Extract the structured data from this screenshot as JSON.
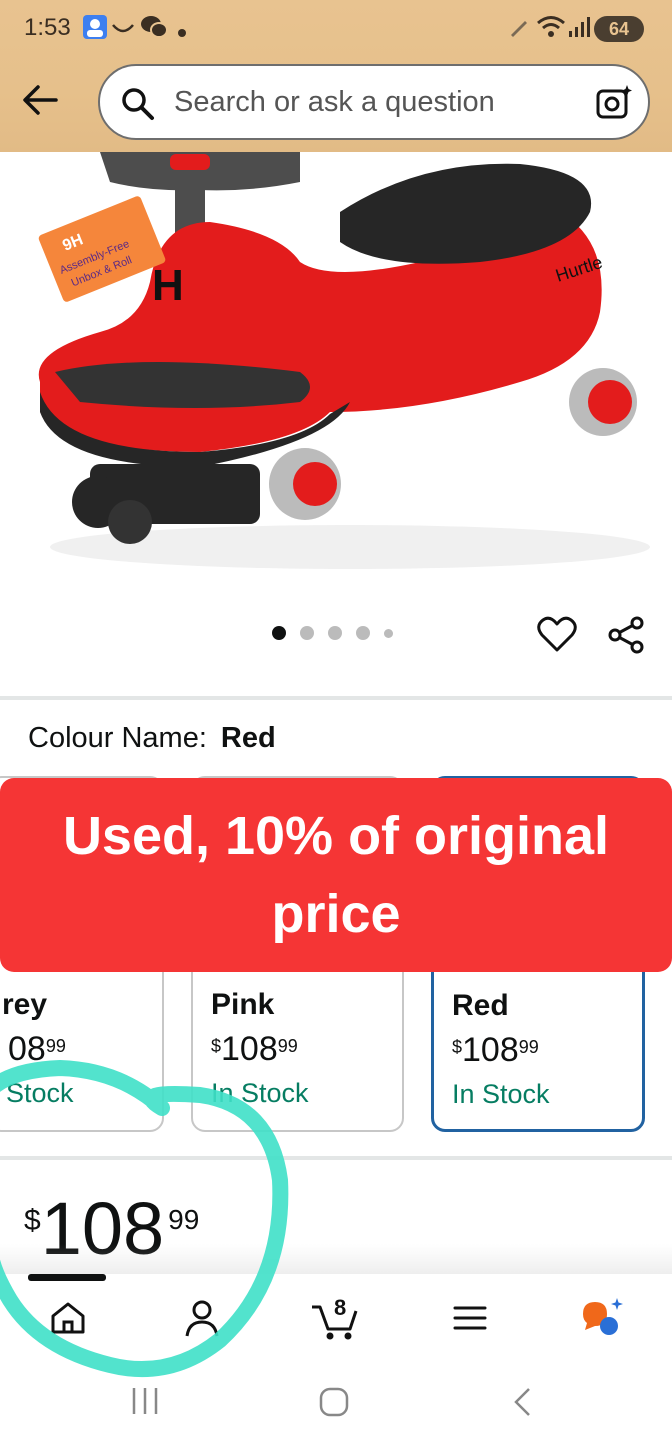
{
  "status_bar": {
    "time": "1:53",
    "battery": "64"
  },
  "header": {
    "search_placeholder": "Search or ask a question"
  },
  "product": {
    "image_label": "Assembly-Free Unbox & Roll",
    "brand_mark": "Hurtle",
    "carousel_dots": 5,
    "carousel_active": 0
  },
  "colour": {
    "label": "Colour Name:",
    "selected": "Red"
  },
  "swatches": [
    {
      "name": "rey",
      "price_whole": "08",
      "price_fraction": "99",
      "stock": "Stock"
    },
    {
      "name": "Pink",
      "currency": "$",
      "price_whole": "108",
      "price_fraction": "99",
      "stock": "In Stock"
    },
    {
      "name": "Red",
      "currency": "$",
      "price_whole": "108",
      "price_fraction": "99",
      "stock": "In Stock"
    }
  ],
  "banner": {
    "text": "Used, 10% of original price"
  },
  "price": {
    "currency": "$",
    "whole": "108",
    "fraction": "99"
  },
  "bottom_nav": {
    "cart_count": "8",
    "items": [
      "home-icon",
      "account-icon",
      "cart-icon",
      "menu-icon",
      "ai-assistant-icon"
    ]
  },
  "colors": {
    "header_bg": "#e8c390",
    "banner": "#f53535",
    "in_stock": "#067d62",
    "selected_border": "#2162a1",
    "annotation": "#3fe0c8"
  }
}
